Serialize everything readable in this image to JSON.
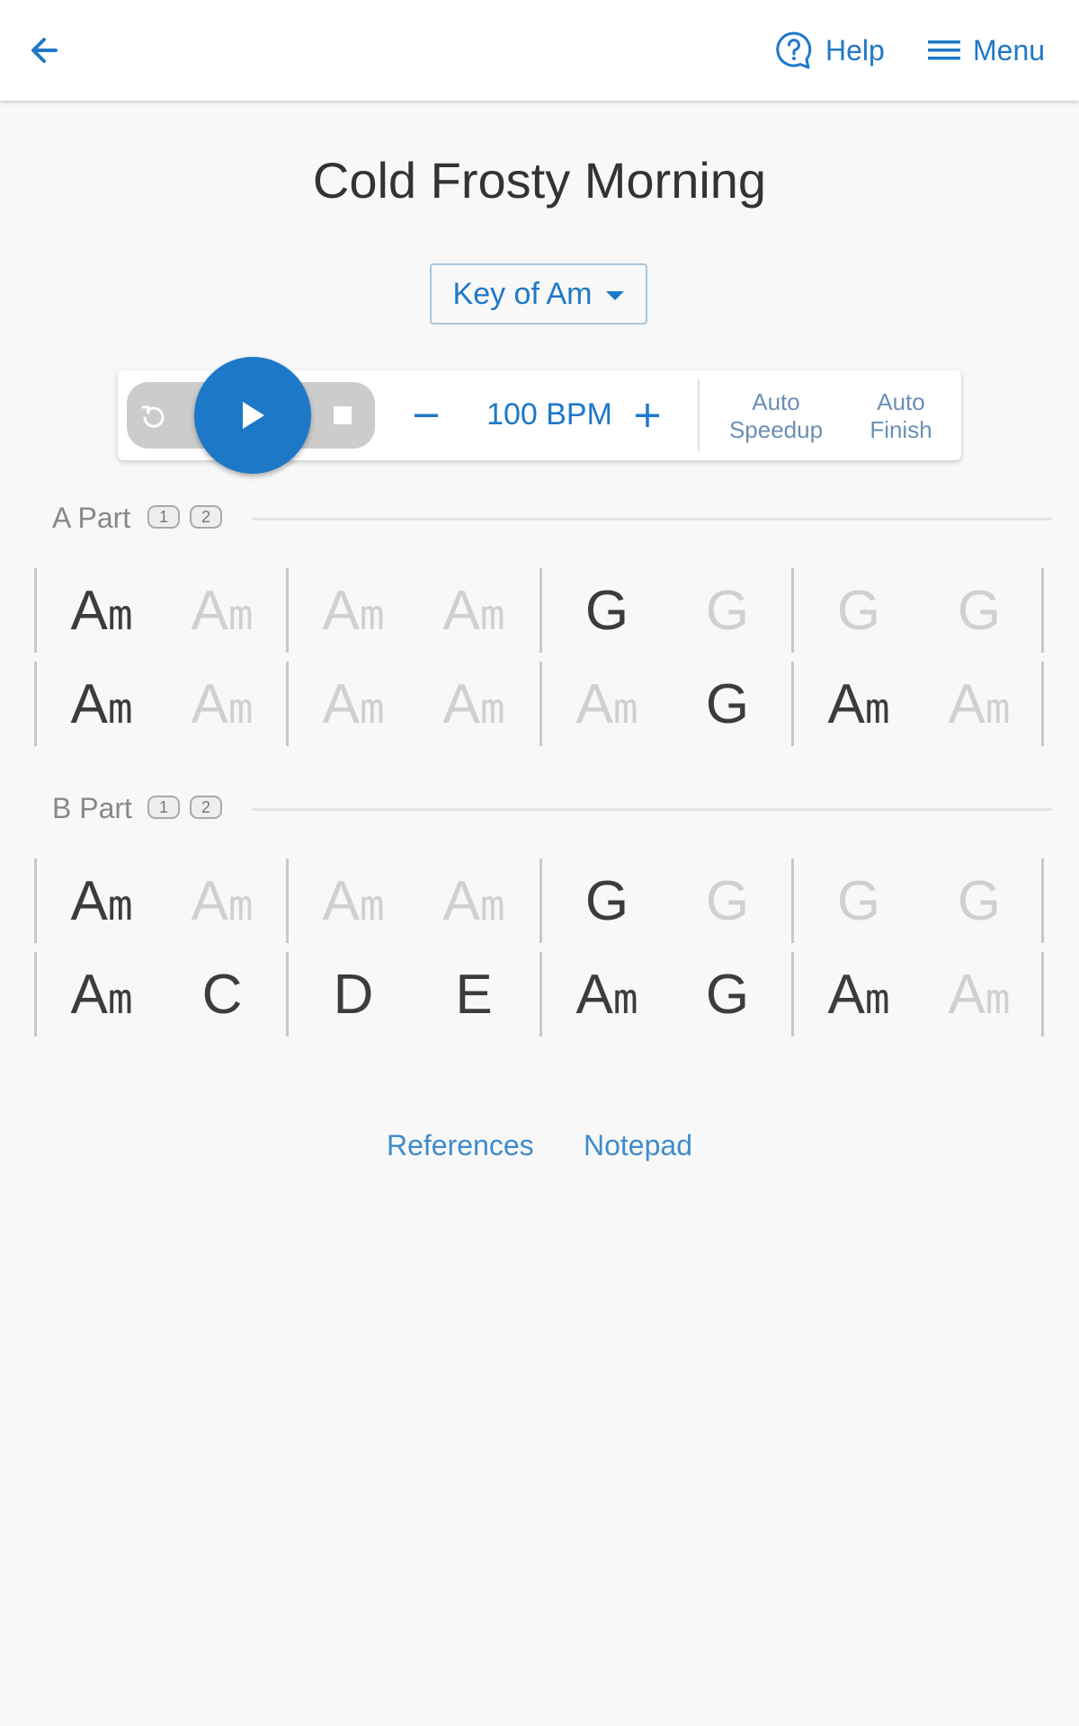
{
  "header": {
    "back_icon": "arrow-left-icon",
    "help_label": "Help",
    "help_icon": "question-bubble-icon",
    "menu_label": "Menu",
    "menu_icon": "hamburger-icon"
  },
  "tune": {
    "title": "Cold Frosty Morning",
    "key_label": "Key of Am"
  },
  "player": {
    "bpm_label": "100 BPM",
    "auto_speedup": [
      "Auto",
      "Speedup"
    ],
    "auto_finish": [
      "Auto",
      "Finish"
    ]
  },
  "parts": [
    {
      "title": "A Part",
      "repeats": [
        "1",
        "2"
      ],
      "rows": [
        [
          [
            "A",
            "m",
            true
          ],
          [
            "A",
            "m",
            false
          ],
          [
            "A",
            "m",
            false
          ],
          [
            "A",
            "m",
            false
          ],
          [
            "G",
            "",
            true
          ],
          [
            "G",
            "",
            false
          ],
          [
            "G",
            "",
            false
          ],
          [
            "G",
            "",
            false
          ]
        ],
        [
          [
            "A",
            "m",
            true
          ],
          [
            "A",
            "m",
            false
          ],
          [
            "A",
            "m",
            false
          ],
          [
            "A",
            "m",
            false
          ],
          [
            "A",
            "m",
            false
          ],
          [
            "G",
            "",
            true
          ],
          [
            "A",
            "m",
            true
          ],
          [
            "A",
            "m",
            false
          ]
        ]
      ]
    },
    {
      "title": "B Part",
      "repeats": [
        "1",
        "2"
      ],
      "rows": [
        [
          [
            "A",
            "m",
            true
          ],
          [
            "A",
            "m",
            false
          ],
          [
            "A",
            "m",
            false
          ],
          [
            "A",
            "m",
            false
          ],
          [
            "G",
            "",
            true
          ],
          [
            "G",
            "",
            false
          ],
          [
            "G",
            "",
            false
          ],
          [
            "G",
            "",
            false
          ]
        ],
        [
          [
            "A",
            "m",
            true
          ],
          [
            "C",
            "",
            true
          ],
          [
            "D",
            "",
            true
          ],
          [
            "E",
            "",
            true
          ],
          [
            "A",
            "m",
            true
          ],
          [
            "G",
            "",
            true
          ],
          [
            "A",
            "m",
            true
          ],
          [
            "A",
            "m",
            false
          ]
        ]
      ]
    }
  ],
  "footer": {
    "references_label": "References",
    "notepad_label": "Notepad"
  },
  "colors": {
    "accent": "#1e78c8",
    "chord_active": "#3c3c3c",
    "chord_inactive": "#d0d0d0"
  }
}
